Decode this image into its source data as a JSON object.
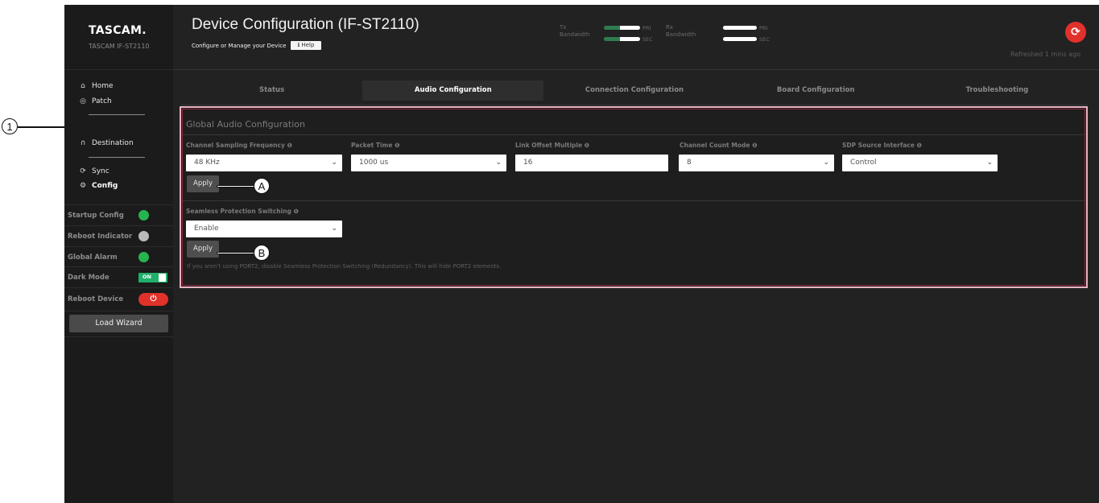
{
  "brand": {
    "logo": "TASCAM.",
    "model": "TASCAM IF-ST2110"
  },
  "nav": [
    {
      "label": "Home",
      "icon": "home-icon",
      "glyph": "⌂"
    },
    {
      "label": "Patch",
      "icon": "patch-icon",
      "glyph": "◎"
    },
    {
      "label": "Destination",
      "icon": "headphones-icon",
      "glyph": "∩"
    },
    {
      "label": "Sync",
      "icon": "sync-icon",
      "glyph": "⟳"
    },
    {
      "label": "Config",
      "icon": "gear-icon",
      "glyph": "⚙"
    }
  ],
  "status_rows": [
    {
      "label": "Startup Config",
      "type": "led",
      "color": "#27b350"
    },
    {
      "label": "Reboot Indicator",
      "type": "led",
      "color": "#b9b9b9"
    },
    {
      "label": "Global Alarm",
      "type": "led",
      "color": "#27b350"
    },
    {
      "label": "Dark Mode",
      "type": "toggle",
      "value": "ON"
    },
    {
      "label": "Reboot Device",
      "type": "power",
      "glyph": "⏻"
    }
  ],
  "wizard_label": "Load Wizard",
  "header": {
    "title": "Device Configuration (IF-ST2110)",
    "subtitle": "Configure or Manage your Device",
    "help_label": "Help",
    "tx_label_1": "Tx",
    "tx_label_2": "Bandwidth",
    "rx_label_1": "Rx",
    "rx_label_2": "Bandwidth",
    "pri": "PRI",
    "sec": "SEC",
    "refreshed": "Refreshed 1 mins ago"
  },
  "tabs": [
    {
      "label": "Status",
      "active": false
    },
    {
      "label": "Audio Configuration",
      "active": true
    },
    {
      "label": "Connection Configuration",
      "active": false
    },
    {
      "label": "Board Configuration",
      "active": false
    },
    {
      "label": "Troubleshooting",
      "active": false
    }
  ],
  "global_audio": {
    "title": "Global Audio Configuration",
    "fields": [
      {
        "label": "Channel Sampling Frequency",
        "value": "48 KHz",
        "kind": "select"
      },
      {
        "label": "Packet Time",
        "value": "1000 us",
        "kind": "select"
      },
      {
        "label": "Link Offset Multiple",
        "value": "16",
        "kind": "input"
      },
      {
        "label": "Channel Count Mode",
        "value": "8",
        "kind": "select"
      },
      {
        "label": "SDP Source Interface",
        "value": "Control",
        "kind": "select"
      }
    ],
    "apply_label": "Apply"
  },
  "seamless": {
    "label": "Seamless Protection Switching",
    "value": "Enable",
    "apply_label": "Apply",
    "note": "If you aren't using PORT2, disable Seamless Protection Switching (Redundancy). This will hide PORT2 elements."
  },
  "callouts": {
    "one": "1",
    "a": "A",
    "b": "B"
  },
  "colors": {
    "accent_red": "#e0312b",
    "accent_green": "#27b350",
    "highlight_frame": "#e8b3c3"
  }
}
